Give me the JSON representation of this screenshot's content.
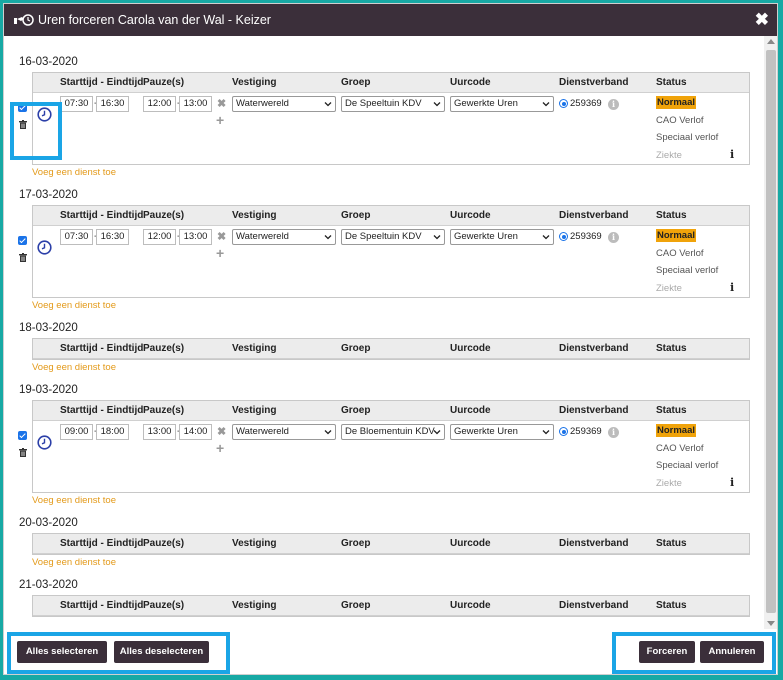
{
  "dialog": {
    "title": "Uren forceren Carola van der Wal - Keizer",
    "close_symbol": "✖"
  },
  "columns": [
    "Starttijd - Eindtijd",
    "Pauze(s)",
    "Vestiging",
    "Groep",
    "Uurcode",
    "Dienstverband",
    "Status"
  ],
  "add_shift_label": "Voeg een dienst toe",
  "status_options": [
    "Normaal",
    "CAO Verlof",
    "Speciaal verlof",
    "Ziekte"
  ],
  "days": [
    {
      "date": "16-03-2020",
      "shift": {
        "start": "07:30",
        "end": "16:30",
        "pause_start": "12:00",
        "pause_end": "13:00",
        "vestiging": "Waterwereld",
        "groep": "De Speeltuin KDV",
        "uurcode": "Gewerkte Uren",
        "dienstverband": "259369",
        "status": "Normaal",
        "checked": true
      }
    },
    {
      "date": "17-03-2020",
      "shift": {
        "start": "07:30",
        "end": "16:30",
        "pause_start": "12:00",
        "pause_end": "13:00",
        "vestiging": "Waterwereld",
        "groep": "De Speeltuin KDV",
        "uurcode": "Gewerkte Uren",
        "dienstverband": "259369",
        "status": "Normaal",
        "checked": true
      }
    },
    {
      "date": "18-03-2020",
      "shift": null
    },
    {
      "date": "19-03-2020",
      "shift": {
        "start": "09:00",
        "end": "18:00",
        "pause_start": "13:00",
        "pause_end": "14:00",
        "vestiging": "Waterwereld",
        "groep": "De Bloementuin KDV",
        "uurcode": "Gewerkte Uren",
        "dienstverband": "259369",
        "status": "Normaal",
        "checked": true
      }
    },
    {
      "date": "20-03-2020",
      "shift": null
    },
    {
      "date": "21-03-2020",
      "shift": null
    }
  ],
  "footer": {
    "select_all": "Alles selecteren",
    "deselect_all": "Alles deselecteren",
    "force": "Forceren",
    "cancel": "Annuleren"
  },
  "colors": {
    "titlebar": "#3b2f3a",
    "accent_status": "#f0a30a",
    "link": "#e39a1a",
    "highlight": "#1aa5e6",
    "background": "#17a9a4"
  }
}
